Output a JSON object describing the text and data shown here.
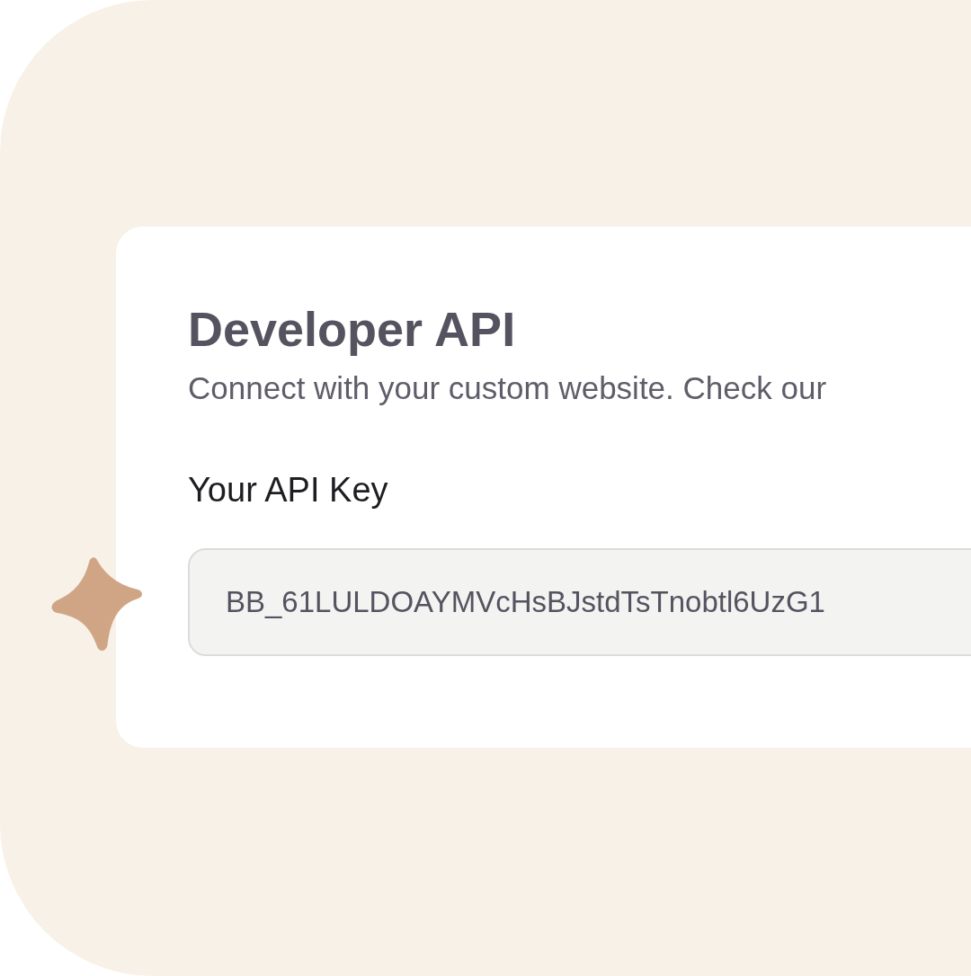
{
  "card": {
    "title": "Developer API",
    "subtitle": "Connect with your custom website. Check our",
    "field_label": "Your API Key",
    "api_key": {
      "value": "BB_61LULDOAYMVcHsBJstdTsTnobtl6UzG1"
    }
  }
}
